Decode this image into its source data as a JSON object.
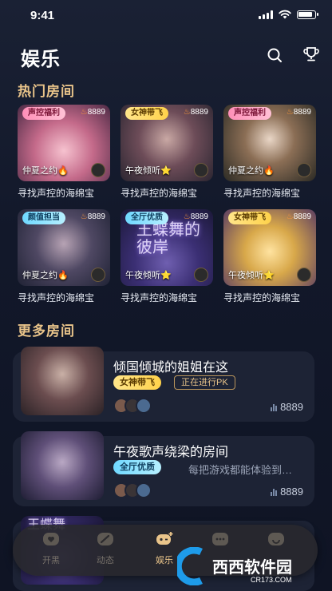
{
  "status_bar": {
    "time": "9:41"
  },
  "header": {
    "title": "娱乐"
  },
  "hot_rooms": {
    "title": "热门房间",
    "cards": [
      {
        "tag": "声控福利",
        "views": "8889",
        "host": "仲夏之约🔥",
        "name": "寻找声控的海绵宝"
      },
      {
        "tag": "女神带飞",
        "views": "8889",
        "host": "午夜倾听⭐",
        "name": "寻找声控的海绵宝"
      },
      {
        "tag": "声控福利",
        "views": "8889",
        "host": "仲夏之约🔥",
        "name": "寻找声控的海绵宝"
      },
      {
        "tag": "颜值担当",
        "views": "8889",
        "host": "仲夏之约🔥",
        "name": "寻找声控的海绵宝"
      },
      {
        "tag": "全厅优质",
        "views": "8889",
        "host": "午夜倾听⭐",
        "name": "寻找声控的海绵宝",
        "overlay": "王蝶舞的彼岸"
      },
      {
        "tag": "女神带飞",
        "views": "8889",
        "host": "午夜倾听⭐",
        "name": "寻找声控的海绵宝"
      }
    ]
  },
  "more_rooms": {
    "title": "更多房间",
    "rooms": [
      {
        "title": "倾国倾城的姐姐在这",
        "tag": "女神带飞",
        "status": "正在进行PK",
        "count": "8889"
      },
      {
        "title": "午夜歌声绕梁的房间",
        "tag": "全厅优质",
        "desc": "每把游戏都能体验到…",
        "count": "8889"
      }
    ],
    "partial_overlay": "王蝶舞"
  },
  "tabbar": {
    "tabs": [
      {
        "label": "开黑"
      },
      {
        "label": "动态"
      },
      {
        "label": "娱乐"
      },
      {
        "label": ""
      },
      {
        "label": ""
      }
    ]
  },
  "watermark": {
    "text": "西西软件园",
    "url": "CR173.COM"
  },
  "colors": {
    "accent": "#e9c48a",
    "pink_tag": "#ff8fb8",
    "yellow_tag": "#ffd24a",
    "blue_tag": "#6fd8ff"
  }
}
